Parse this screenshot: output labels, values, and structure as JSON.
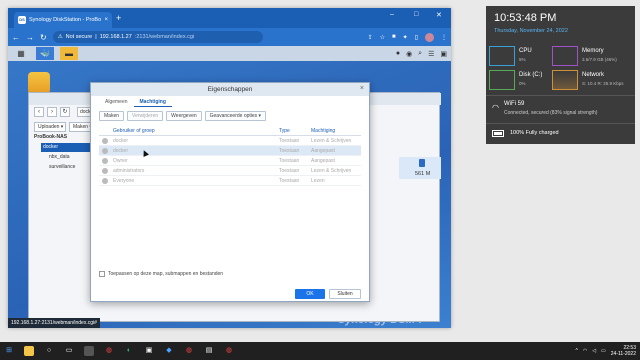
{
  "browser": {
    "tab_title": "Synology DiskStation - ProBook",
    "tab_close": "×",
    "new_tab": "+",
    "url_warning": "Not secure",
    "url_host": "192.168.1.27",
    "url_rest": ":2131/webman/index.cgi",
    "win_min": "–",
    "win_max": "□",
    "win_close": "✕",
    "status_url": "192.168.1.27:2131/webman/index.cgi#"
  },
  "dsm": {
    "watermark": "Synology DSM 7"
  },
  "filestation": {
    "path": "docker",
    "upload_label": "Uploaden ▾",
    "maken_label": "Maken ▾",
    "tree": [
      {
        "label": "ProBook-NAS"
      },
      {
        "label": "docker"
      },
      {
        "label": "nbx_data"
      },
      {
        "label": "surveillance"
      }
    ],
    "size": "561 M"
  },
  "dialog": {
    "title": "Eigenschappen",
    "close": "×",
    "tabs": [
      {
        "label": "Algemeen"
      },
      {
        "label": "Machtiging"
      }
    ],
    "toolbar": {
      "maken": "Maken",
      "verwijderen": "Verwijderen",
      "bewerken": "Weergeven",
      "geavanceerd": "Geavanceerde opties ▾"
    },
    "columns": {
      "user": "Gebruiker of groep",
      "type": "Type",
      "perm": "Machtiging"
    },
    "rows": [
      {
        "name": "docker",
        "type": "Toestaan",
        "perm": "Lezen & Schrijven"
      },
      {
        "name": "docker",
        "type": "Toestaan",
        "perm": "Aangepast"
      },
      {
        "name": "Owner",
        "type": "Toestaan",
        "perm": "Aangepast"
      },
      {
        "name": "administrators",
        "type": "Toestaan",
        "perm": "Lezen & Schrijven"
      },
      {
        "name": "Everyone",
        "type": "Toestaan",
        "perm": "Lezen"
      }
    ],
    "apply_label": "Toepassen op deze map, submappen en bestanden",
    "ok": "OK",
    "close_btn": "Sluiten"
  },
  "widget": {
    "time": "10:53:48 PM",
    "date": "Thursday, November 24, 2022",
    "cpu": {
      "name": "CPU",
      "value": "5%"
    },
    "memory": {
      "name": "Memory",
      "value": "3.6/7.9 GB (46%)"
    },
    "disk": {
      "name": "Disk (C:)",
      "value": "0%"
    },
    "network": {
      "name": "Network",
      "value": "S: 10.4  R: 25.9 Kbps"
    },
    "wifi_name": "WiFi 59",
    "wifi_status": "Connected, secured (83% signal strength)",
    "battery": "100%  Fully charged"
  },
  "taskbar": {
    "time": "22:53",
    "date": "24-11-2022"
  }
}
